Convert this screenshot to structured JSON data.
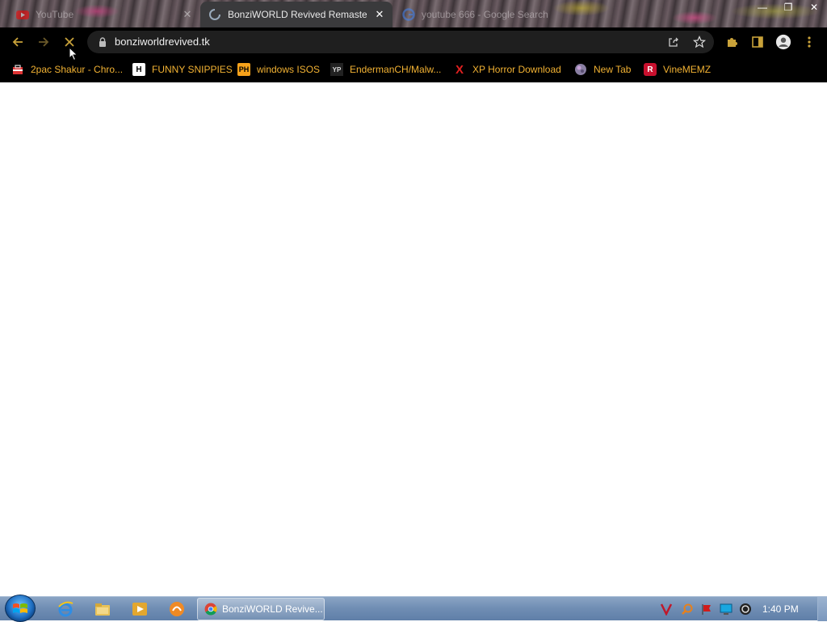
{
  "browser": {
    "tabs": [
      {
        "title": "YouTube",
        "active": false
      },
      {
        "title": "BonziWORLD Revived Remastered",
        "active": true
      },
      {
        "title": "youtube 666 - Google Search",
        "active": false
      }
    ],
    "toolbar": {
      "url": "bonziworldrevived.tk"
    },
    "bookmarks": [
      {
        "label": "2pac Shakur - Chro...",
        "icon": "briefcase-icon"
      },
      {
        "label": "FUNNY SNIPPIES",
        "icon": "h-logo-icon"
      },
      {
        "label": "windows ISOS",
        "icon": "ph-logo-icon"
      },
      {
        "label": "EndermanCH/Malw...",
        "icon": "yp-logo-icon"
      },
      {
        "label": "XP Horror Download",
        "icon": "x-logo-icon"
      },
      {
        "label": "New Tab",
        "icon": "globe-icon"
      },
      {
        "label": "VineMEMZ",
        "icon": "r-logo-icon"
      }
    ],
    "colors": {
      "bookmark_text": "#f2b233",
      "toolbar_bg": "#000000",
      "omnibox_bg": "#1f1f1f"
    }
  },
  "taskbar": {
    "task_button_label": "BonziWORLD Revive...",
    "clock": "1:40 PM",
    "pinned": [
      "internet-explorer-icon",
      "file-explorer-icon",
      "media-player-icon",
      "app-icon"
    ],
    "tray": [
      "tray-v-icon",
      "tray-search-icon",
      "tray-flag-icon",
      "tray-monitor-icon",
      "tray-volume-icon"
    ]
  }
}
